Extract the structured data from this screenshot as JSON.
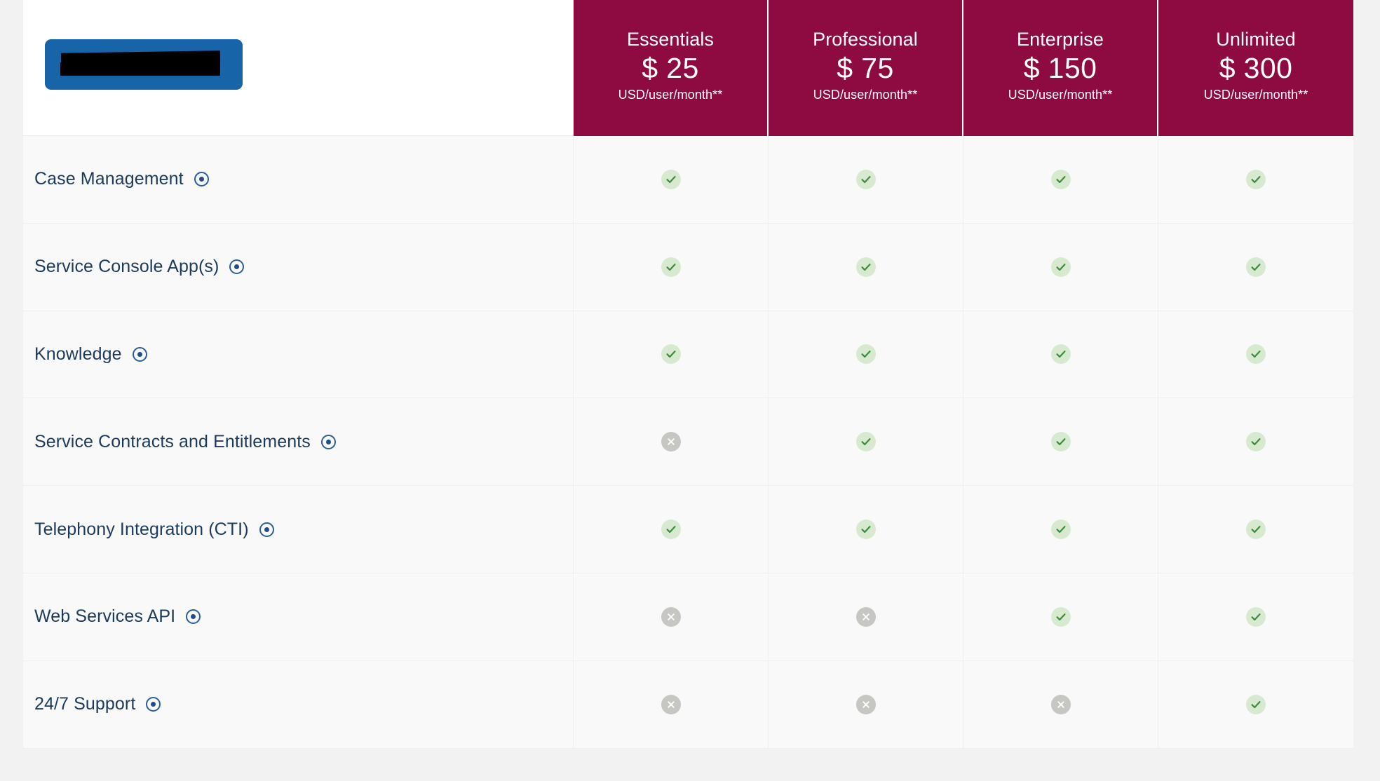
{
  "page": {
    "background_color": "#f2f2f2",
    "table_background_color": "#f9f9f9"
  },
  "table": {
    "header": {
      "logo": {
        "icon_name": "company-logo-redacted",
        "background_color": "#1764a8",
        "redaction_color": "#000000",
        "alt": ""
      },
      "accent_color": "#8e0b41",
      "plans": [
        {
          "name": "Essentials",
          "price": "$ 25",
          "unit": "USD/user/month**"
        },
        {
          "name": "Professional",
          "price": "$ 75",
          "unit": "USD/user/month**"
        },
        {
          "name": "Enterprise",
          "price": "$ 150",
          "unit": "USD/user/month**"
        },
        {
          "name": "Unlimited",
          "price": "$ 300",
          "unit": "USD/user/month**"
        }
      ]
    },
    "label_color": "#1b3a5c",
    "icons": {
      "info": "info-ring-icon",
      "included": "check-circle-icon",
      "excluded": "x-circle-icon",
      "included_bg": "#d7ead0",
      "included_fg": "#3c8c3c",
      "excluded_bg": "#c6c6c2",
      "excluded_fg": "#ffffff"
    },
    "rows": [
      {
        "label": "Case Management",
        "values": [
          "yes",
          "yes",
          "yes",
          "yes"
        ]
      },
      {
        "label": "Service Console App(s)",
        "values": [
          "yes",
          "yes",
          "yes",
          "yes"
        ]
      },
      {
        "label": "Knowledge",
        "values": [
          "yes",
          "yes",
          "yes",
          "yes"
        ]
      },
      {
        "label": "Service Contracts and Entitlements",
        "values": [
          "no",
          "yes",
          "yes",
          "yes"
        ]
      },
      {
        "label": "Telephony Integration (CTI)",
        "values": [
          "yes",
          "yes",
          "yes",
          "yes"
        ]
      },
      {
        "label": "Web Services API",
        "values": [
          "no",
          "no",
          "yes",
          "yes"
        ]
      },
      {
        "label": "24/7 Support",
        "values": [
          "no",
          "no",
          "no",
          "yes"
        ]
      }
    ]
  }
}
